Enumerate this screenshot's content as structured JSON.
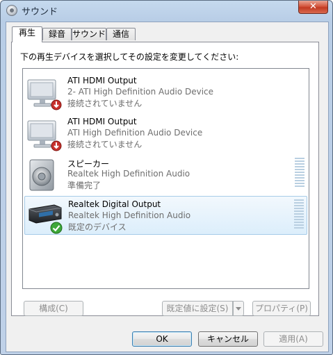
{
  "window": {
    "title": "サウンド",
    "close_label": "✕"
  },
  "tabs": [
    {
      "label": "再生",
      "active": true
    },
    {
      "label": "録音",
      "active": false
    },
    {
      "label": "サウンド",
      "active": false
    },
    {
      "label": "通信",
      "active": false
    }
  ],
  "instruction": "下の再生デバイスを選択してその設定を変更してください:",
  "devices": [
    {
      "name": "ATI HDMI Output",
      "description": "2- ATI High Definition Audio Device",
      "status": "接続されていません",
      "icon": "monitor-icon",
      "badge": "disconnected-badge-icon"
    },
    {
      "name": "ATI HDMI Output",
      "description": "ATI High Definition Audio Device",
      "status": "接続されていません",
      "icon": "monitor-icon",
      "badge": "disconnected-badge-icon"
    },
    {
      "name": "スピーカー",
      "description": "Realtek High Definition Audio",
      "status": "準備完了",
      "icon": "speaker-icon"
    },
    {
      "name": "Realtek Digital Output",
      "description": "Realtek High Definition Audio",
      "status": "既定のデバイス",
      "icon": "digital-receiver-icon",
      "badge": "default-check-icon",
      "selected": true
    }
  ],
  "buttons": {
    "configure": "構成(C)",
    "set_default": "既定値に設定(S)",
    "properties": "プロパティ(P)",
    "ok": "OK",
    "cancel": "キャンセル",
    "apply": "適用(A)"
  },
  "colors": {
    "selection": "#dceefb",
    "close": "#c23a22",
    "meter": "#b9cfe1"
  }
}
